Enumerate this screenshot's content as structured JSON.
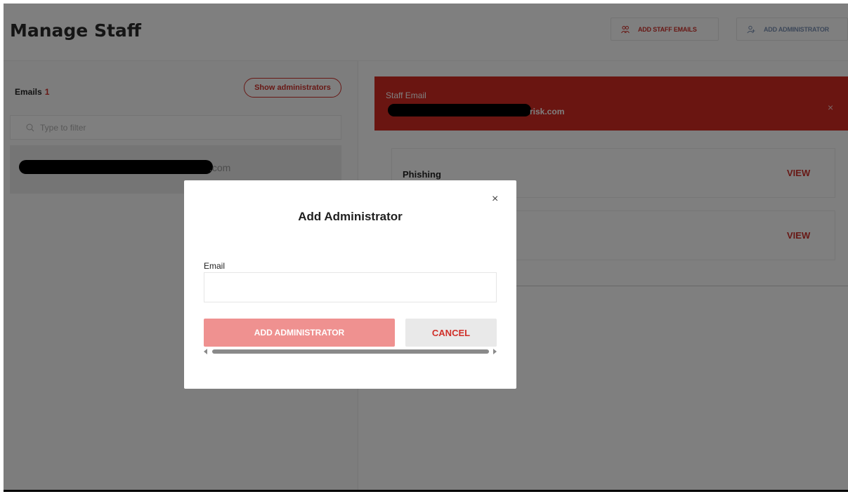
{
  "header": {
    "title": "Manage Staff",
    "add_staff_emails_label": "ADD STAFF EMAILS",
    "add_administrator_label": "ADD ADMINISTRATOR"
  },
  "sidebar": {
    "emails_label": "Emails",
    "emails_count": "1",
    "show_admins_label": "Show administrators",
    "filter_placeholder": "Type to filter",
    "selected_email_suffix": ".com"
  },
  "detail": {
    "staff_email_label": "Staff Email",
    "staff_email_suffix": "risk.com",
    "close_glyph": "×",
    "cards": [
      {
        "name": "Phishing",
        "action": "VIEW"
      },
      {
        "name": "",
        "action": "VIEW"
      }
    ]
  },
  "modal": {
    "title": "Add Administrator",
    "close_glyph": "×",
    "email_label": "Email",
    "email_value": "",
    "submit_label": "ADD ADMINISTRATOR",
    "cancel_label": "CANCEL"
  },
  "colors": {
    "accent": "#d0302a",
    "staff_header_bg": "#d42a22",
    "submit_bg": "#ef9190"
  }
}
